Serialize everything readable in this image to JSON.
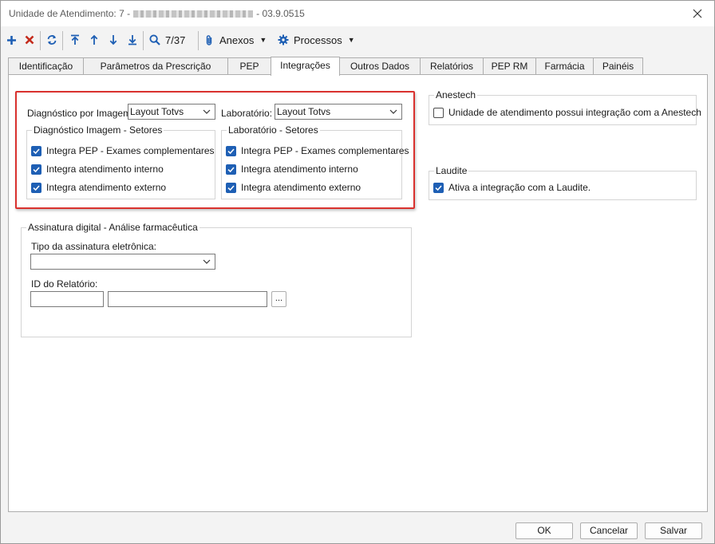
{
  "window": {
    "title_prefix": "Unidade de Atendimento: 7 -",
    "title_suffix": "- 03.9.0515"
  },
  "toolbar": {
    "counter": "7/37",
    "anexos_label": "Anexos",
    "processos_label": "Processos"
  },
  "tabs": [
    {
      "label": "Identificação"
    },
    {
      "label": "Parâmetros da Prescrição"
    },
    {
      "label": "PEP"
    },
    {
      "label": "Integrações"
    },
    {
      "label": "Outros Dados"
    },
    {
      "label": "Relatórios"
    },
    {
      "label": "PEP RM"
    },
    {
      "label": "Farmácia"
    },
    {
      "label": "Painéis"
    }
  ],
  "integracoes": {
    "diag_imagem_label": "Diagnóstico por Imagem:",
    "diag_imagem_value": "Layout Totvs",
    "laboratorio_label": "Laboratório:",
    "laboratorio_value": "Layout Totvs",
    "diag_setores": {
      "title": "Diagnóstico Imagem - Setores",
      "items": [
        {
          "label": "Integra PEP - Exames complementares",
          "checked": true
        },
        {
          "label": "Integra atendimento interno",
          "checked": true
        },
        {
          "label": "Integra atendimento externo",
          "checked": true
        }
      ]
    },
    "lab_setores": {
      "title": "Laboratório - Setores",
      "items": [
        {
          "label": "Integra PEP - Exames complementares",
          "checked": true
        },
        {
          "label": "Integra atendimento interno",
          "checked": true
        },
        {
          "label": "Integra atendimento externo",
          "checked": true
        }
      ]
    },
    "anestech": {
      "title": "Anestech",
      "label": "Unidade de atendimento possui integração com a Anestech",
      "checked": false
    },
    "laudite": {
      "title": "Laudite",
      "label": "Ativa a integração com a Laudite.",
      "checked": true
    },
    "assinatura": {
      "title": "Assinatura digital - Análise farmacêutica",
      "tipo_label": "Tipo da assinatura eletrônica:",
      "tipo_value": "",
      "id_label": "ID do Relatório:",
      "id_value": "",
      "id_desc_value": "",
      "lookup_label": "..."
    }
  },
  "footer": {
    "ok": "OK",
    "cancel": "Cancelar",
    "save": "Salvar"
  },
  "colors": {
    "accent_blue": "#1e5fb4",
    "delete_red": "#c42b1c",
    "highlight_red": "#d9312e"
  }
}
